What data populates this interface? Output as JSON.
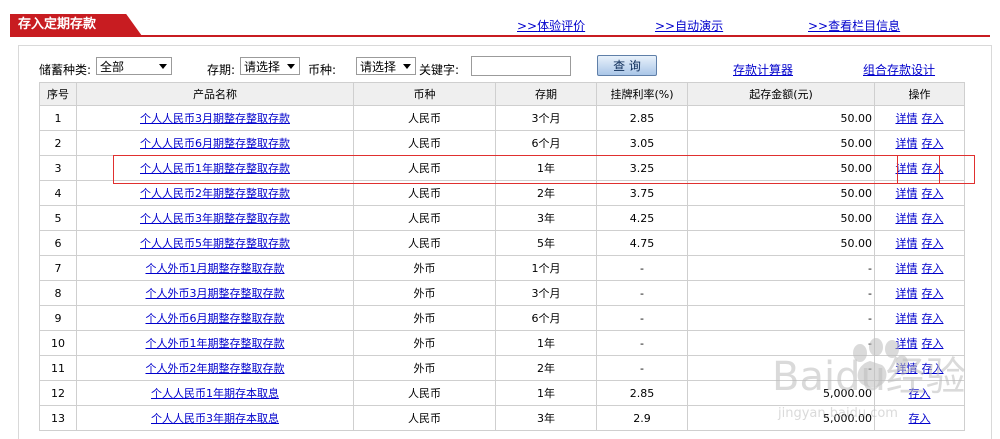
{
  "header": {
    "tab_title": "存入定期存款",
    "links": [
      "体验评价",
      "自动演示",
      "查看栏目信息"
    ],
    "arrow": ">>"
  },
  "filters": {
    "category_label": "储蓄种类:",
    "category_value": "全部",
    "term_label": "存期:",
    "term_value": "请选择",
    "currency_label": "币种:",
    "currency_value": "请选择",
    "keyword_label": "关键字:",
    "keyword_value": "",
    "query_button": "查 询",
    "calculator_link": "存款计算器",
    "design_link": "组合存款设计"
  },
  "table": {
    "headers": [
      "序号",
      "产品名称",
      "币种",
      "存期",
      "挂牌利率(%)",
      "起存金额(元)",
      "操作"
    ],
    "detail_label": "详情",
    "deposit_label": "存入",
    "rows": [
      {
        "no": "1",
        "name": "个人人民币3月期整存整取存款",
        "currency": "人民币",
        "term": "3个月",
        "rate": "2.85",
        "min": "50.00",
        "detail": true
      },
      {
        "no": "2",
        "name": "个人人民币6月期整存整取存款",
        "currency": "人民币",
        "term": "6个月",
        "rate": "3.05",
        "min": "50.00",
        "detail": true
      },
      {
        "no": "3",
        "name": "个人人民币1年期整存整取存款",
        "currency": "人民币",
        "term": "1年",
        "rate": "3.25",
        "min": "50.00",
        "detail": true
      },
      {
        "no": "4",
        "name": "个人人民币2年期整存整取存款",
        "currency": "人民币",
        "term": "2年",
        "rate": "3.75",
        "min": "50.00",
        "detail": true
      },
      {
        "no": "5",
        "name": "个人人民币3年期整存整取存款",
        "currency": "人民币",
        "term": "3年",
        "rate": "4.25",
        "min": "50.00",
        "detail": true
      },
      {
        "no": "6",
        "name": "个人人民币5年期整存整取存款",
        "currency": "人民币",
        "term": "5年",
        "rate": "4.75",
        "min": "50.00",
        "detail": true
      },
      {
        "no": "7",
        "name": "个人外币1月期整存整取存款",
        "currency": "外币",
        "term": "1个月",
        "rate": "-",
        "min": "-",
        "detail": true
      },
      {
        "no": "8",
        "name": "个人外币3月期整存整取存款",
        "currency": "外币",
        "term": "3个月",
        "rate": "-",
        "min": "-",
        "detail": true
      },
      {
        "no": "9",
        "name": "个人外币6月期整存整取存款",
        "currency": "外币",
        "term": "6个月",
        "rate": "-",
        "min": "-",
        "detail": true
      },
      {
        "no": "10",
        "name": "个人外币1年期整存整取存款",
        "currency": "外币",
        "term": "1年",
        "rate": "-",
        "min": "-",
        "detail": true
      },
      {
        "no": "11",
        "name": "个人外币2年期整存整取存款",
        "currency": "外币",
        "term": "2年",
        "rate": "-",
        "min": "-",
        "detail": true
      },
      {
        "no": "12",
        "name": "个人人民币1年期存本取息",
        "currency": "人民币",
        "term": "1年",
        "rate": "2.85",
        "min": "5,000.00",
        "detail": false
      },
      {
        "no": "13",
        "name": "个人人民币3年期存本取息",
        "currency": "人民币",
        "term": "3年",
        "rate": "2.9",
        "min": "5,000.00",
        "detail": false
      }
    ]
  },
  "watermark": {
    "text": "Baidu经验",
    "sub": "jingyan.baidu.com"
  },
  "colors": {
    "accent": "#c81c21",
    "link": "#0000cc",
    "highlight": "#e0302f"
  }
}
